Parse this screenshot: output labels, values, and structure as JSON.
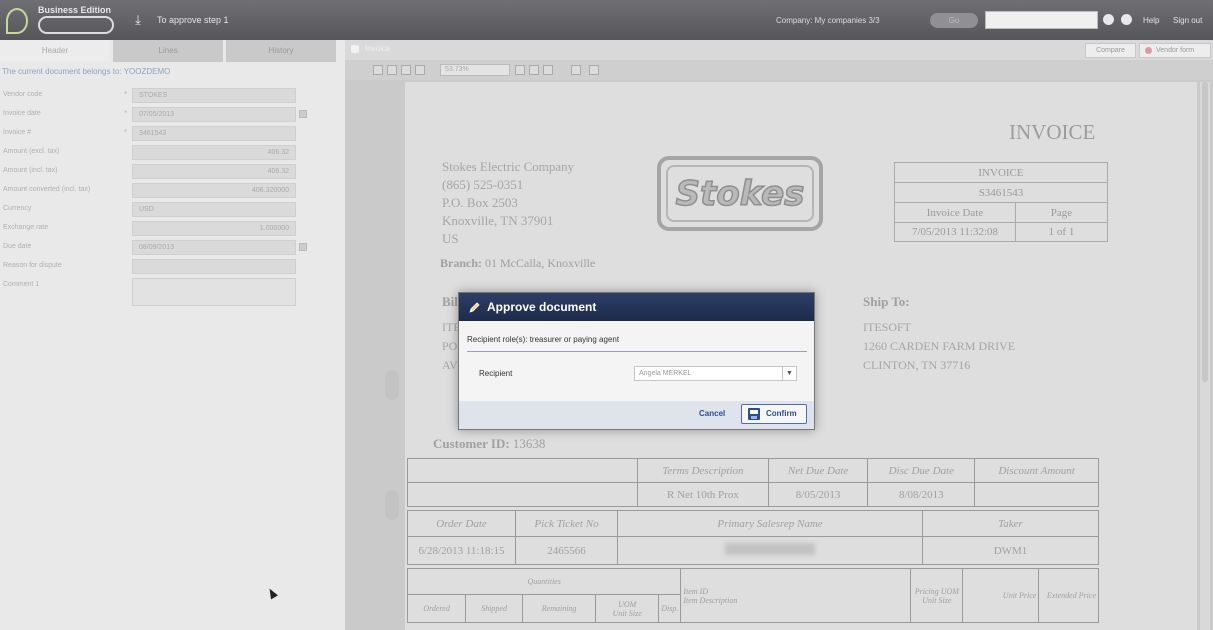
{
  "app": {
    "edition": "Business Edition",
    "step": "To approve step 1",
    "company": "Company: My companies  3/3",
    "go_label": "Go",
    "help": "Help",
    "signout": "Sign out"
  },
  "left": {
    "tabs": [
      "Header",
      "Lines",
      "History"
    ],
    "owner": "The current document belongs to: YOOZDEMO",
    "fields": [
      {
        "label": "Vendor code",
        "value": "STOKES"
      },
      {
        "label": "Invoice date",
        "value": "07/05/2013"
      },
      {
        "label": "Invoice #",
        "value": "3461543"
      },
      {
        "label": "Amount (excl. tax)",
        "value": "406.32"
      },
      {
        "label": "Amount (incl. tax)",
        "value": "406.32"
      },
      {
        "label": "Amount converted (incl. tax)",
        "value": "406.320000"
      },
      {
        "label": "Currency",
        "value": "USD"
      },
      {
        "label": "Exchange rate",
        "value": "1.000000"
      },
      {
        "label": "Due date",
        "value": "08/09/2013"
      },
      {
        "label": "Reason for dispute",
        "value": ""
      },
      {
        "label": "Comment 1",
        "value": ""
      }
    ]
  },
  "viewer": {
    "title": "Invoice",
    "compare": "Compare",
    "vendor_form": "Vendor form",
    "zoom": "53.73%"
  },
  "invoice": {
    "title": "INVOICE",
    "company_lines": [
      "Stokes Electric Company",
      "(865) 525-0351",
      "P.O. Box 2503",
      "Knoxville, TN 37901",
      "US"
    ],
    "branch_label": "Branch:",
    "branch_value": "01  McCalla, Knoxville",
    "logo_text": "Stokes",
    "box_title": "INVOICE",
    "box_number": "S3461543",
    "box_date_label": "Invoice Date",
    "box_page_label": "Page",
    "box_date_value": "7/05/2013  11:32:08",
    "box_page_value": "1 of 1",
    "bill_to": "Bill To:",
    "bill_lines": [
      "ITESOFT",
      "PO BOX",
      "AV"
    ],
    "ship_to": "Ship To:",
    "ship_lines": [
      "ITESOFT",
      "1260 CARDEN FARM DRIVE",
      "CLINTON, TN 37716"
    ],
    "customer_label": "Customer ID:",
    "customer_value": "13638",
    "terms": {
      "headers": [
        "Terms Description",
        "Net Due Date",
        "Disc Due Date",
        "Discount Amount"
      ],
      "values": [
        "R Net 10th Prox",
        "8/05/2013",
        "8/08/2013",
        ""
      ]
    },
    "order": {
      "headers": [
        "Order Date",
        "Pick Ticket No",
        "Primary Salesrep Name",
        "Taker"
      ],
      "values": [
        "6/28/2013 11:18:15",
        "2465566",
        "",
        "DWM1"
      ]
    },
    "qty": {
      "quantities": "Quantities",
      "ordered": "Ordered",
      "shipped": "Shipped",
      "remaining": "Remaining",
      "uom": "UOM",
      "unit_size": "Unit Size",
      "disp": "Disp.",
      "item_id": "Item ID",
      "item_desc": "Item Description",
      "pricing_uom": "Pricing UOM",
      "unit_size2": "Unit Size",
      "unit_price": "Unit Price",
      "extended_price": "Extended Price"
    }
  },
  "dialog": {
    "title": "Approve document",
    "roles": "Recipient role(s): treasurer or paying agent",
    "recipient_label": "Recipient",
    "recipient_value": "Angela MERKEL",
    "cancel": "Cancel",
    "confirm": "Confirm"
  }
}
